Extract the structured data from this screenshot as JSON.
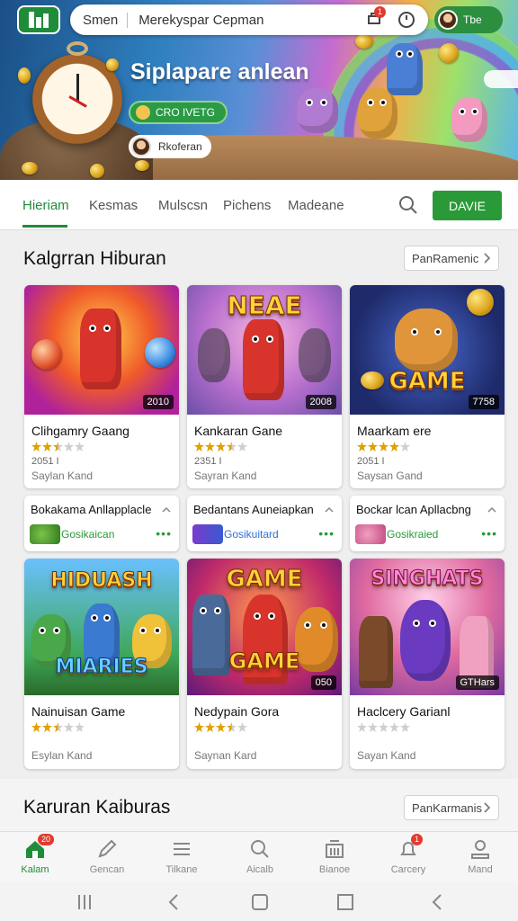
{
  "header": {
    "search_left": "Smen",
    "search_text": "Merekyspar Cepman",
    "notif_badge": "1",
    "notif2_badge": "",
    "profile_label": "Tbe"
  },
  "hero": {
    "title": "Siplapare anlean",
    "button_label": "CRO IVETG",
    "chip_label": "Rkoferan"
  },
  "tabs": [
    "Hieriam",
    "Kesmas",
    "Mulscsn",
    "Pichens",
    "Madeane"
  ],
  "tab_button": "DAVIE",
  "section1": {
    "title": "Kalgrran Hiburan",
    "more": "PanRamenic",
    "cards": [
      {
        "title": "Clihgamry Gaang",
        "tag": "2010",
        "meta": "2051 I",
        "sub": "Saylan Kand",
        "rating": 2.5,
        "word": ""
      },
      {
        "title": "Kankaran Gane",
        "tag": "2008",
        "meta": "2351 I",
        "sub": "Sayran Kand",
        "rating": 3.5,
        "word": "NEAE"
      },
      {
        "title": "Maarkam ere",
        "tag": "7758",
        "meta": "2051 I",
        "sub": "Saysan Gand",
        "rating": 4,
        "word": "GAME"
      }
    ],
    "wide": [
      {
        "title": "Bokakama Anllapplacle",
        "logo_text": "Gosikaican"
      },
      {
        "title": "Bedantans Auneiapkan",
        "logo_text": "Gosikuitard"
      },
      {
        "title": "Bockar lcan Apllacbng",
        "logo_text": "Gosikraied"
      }
    ],
    "cards2": [
      {
        "title": "Nainuisan Game",
        "tag": "",
        "sub": "Esylan Kand",
        "rating": 2.5,
        "word": "HIDUASH"
      },
      {
        "title": "Nedypain Gora",
        "tag": "050",
        "sub": "Saynan Kard",
        "rating": 3.5,
        "word": "GAME"
      },
      {
        "title": "Haclcery Garianl",
        "tag": "GTHars",
        "sub": "Sayan Kand",
        "rating": 0,
        "word": "SINGHATS"
      }
    ]
  },
  "section2": {
    "title": "Karuran Kaiburas",
    "more": "PanKarmanis"
  },
  "bottom_nav": [
    {
      "label": "Kalam",
      "badge": "20"
    },
    {
      "label": "Gencan",
      "badge": ""
    },
    {
      "label": "Tilkane",
      "badge": ""
    },
    {
      "label": "Aicalb",
      "badge": ""
    },
    {
      "label": "Bianoe",
      "badge": ""
    },
    {
      "label": "Carcery",
      "badge": "1"
    },
    {
      "label": "Mand",
      "badge": ""
    }
  ],
  "colors": {
    "accent": "#1f8c3a",
    "button": "#2a9a39",
    "star": "#e0a100",
    "star_empty": "#cfcfcf"
  }
}
